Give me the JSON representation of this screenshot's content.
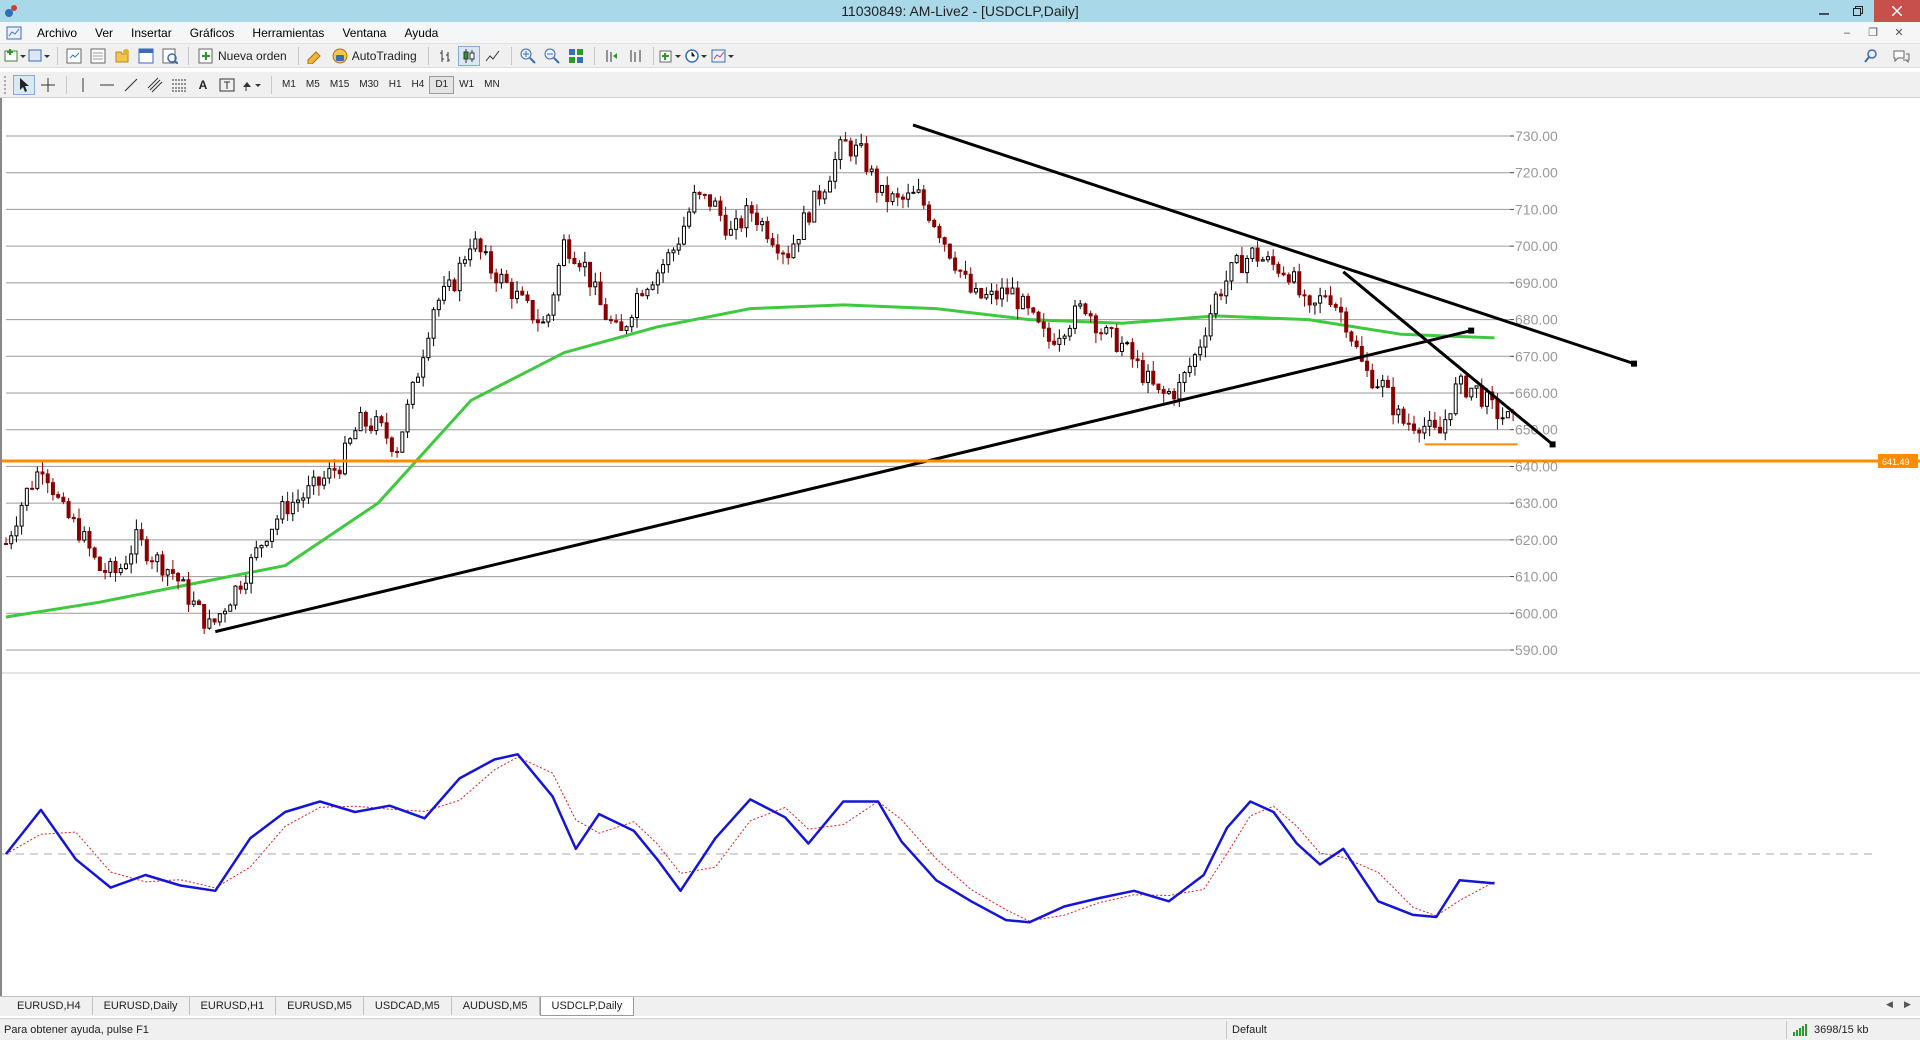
{
  "window": {
    "title": "11030849: AM-Live2 - [USDCLP,Daily]",
    "controls": [
      "minimize",
      "maximize",
      "close"
    ]
  },
  "menu": {
    "items": [
      "Archivo",
      "Ver",
      "Insertar",
      "Gráficos",
      "Herramientas",
      "Ventana",
      "Ayuda"
    ]
  },
  "toolbar": {
    "new_order_label": "Nueva orden",
    "autotrading_label": "AutoTrading",
    "timeframes": [
      "M1",
      "M5",
      "M15",
      "M30",
      "H1",
      "H4",
      "D1",
      "W1",
      "MN"
    ],
    "active_timeframe": "D1"
  },
  "chart": {
    "symbol": "USDCLP",
    "period": "Daily",
    "price_axis_labels": [
      "730.00",
      "720.00",
      "710.00",
      "700.00",
      "690.00",
      "680.00",
      "670.00",
      "660.00",
      "650.00",
      "640.00",
      "630.00",
      "620.00",
      "610.00",
      "600.00",
      "590.00"
    ],
    "horizontal_line_price": "641.49",
    "colors": {
      "bull_candle": "#000000",
      "bear_candle": "#8b0000",
      "moving_average": "#3fc93f",
      "trendline": "#000000",
      "horizontal_line": "#ff8c00",
      "oscillator_main": "#1515d8",
      "oscillator_signal": "#e02020",
      "grid": "#9a9a9a"
    }
  },
  "chart_data": {
    "type": "candlestick",
    "instrument": "USDCLP",
    "timeframe": "Daily",
    "ylim": [
      588,
      733
    ],
    "price_ticks": [
      730,
      720,
      710,
      700,
      690,
      680,
      670,
      660,
      650,
      640,
      630,
      620,
      610,
      600,
      590
    ],
    "close_path": [
      [
        0,
        619
      ],
      [
        8,
        632
      ],
      [
        16,
        641
      ],
      [
        24,
        628
      ],
      [
        32,
        622
      ],
      [
        40,
        612
      ],
      [
        48,
        611
      ],
      [
        56,
        620
      ],
      [
        64,
        615
      ],
      [
        72,
        611
      ],
      [
        80,
        603
      ],
      [
        88,
        596
      ],
      [
        96,
        604
      ],
      [
        104,
        612
      ],
      [
        112,
        622
      ],
      [
        120,
        629
      ],
      [
        128,
        632
      ],
      [
        136,
        636
      ],
      [
        144,
        641
      ],
      [
        152,
        652
      ],
      [
        160,
        651
      ],
      [
        168,
        645
      ],
      [
        176,
        663
      ],
      [
        184,
        684
      ],
      [
        192,
        689
      ],
      [
        200,
        702
      ],
      [
        208,
        694
      ],
      [
        216,
        689
      ],
      [
        224,
        683
      ],
      [
        232,
        678
      ],
      [
        240,
        701
      ],
      [
        248,
        696
      ],
      [
        256,
        683
      ],
      [
        264,
        675
      ],
      [
        272,
        688
      ],
      [
        280,
        693
      ],
      [
        288,
        700
      ],
      [
        296,
        713
      ],
      [
        304,
        712
      ],
      [
        312,
        703
      ],
      [
        320,
        710
      ],
      [
        328,
        704
      ],
      [
        336,
        698
      ],
      [
        344,
        708
      ],
      [
        352,
        717
      ],
      [
        360,
        728
      ],
      [
        368,
        725
      ],
      [
        376,
        714
      ],
      [
        384,
        712
      ],
      [
        392,
        714
      ],
      [
        400,
        706
      ],
      [
        408,
        696
      ],
      [
        416,
        686
      ],
      [
        424,
        686
      ],
      [
        432,
        688
      ],
      [
        440,
        681
      ],
      [
        448,
        674
      ],
      [
        456,
        679
      ],
      [
        464,
        684
      ],
      [
        472,
        676
      ],
      [
        480,
        673
      ],
      [
        488,
        666
      ],
      [
        496,
        659
      ],
      [
        504,
        661
      ],
      [
        512,
        671
      ],
      [
        520,
        686
      ],
      [
        528,
        694
      ],
      [
        536,
        698
      ],
      [
        544,
        695
      ],
      [
        552,
        693
      ],
      [
        560,
        681
      ],
      [
        568,
        688
      ],
      [
        576,
        680
      ],
      [
        584,
        666
      ],
      [
        592,
        662
      ],
      [
        600,
        652
      ],
      [
        608,
        652
      ],
      [
        616,
        648
      ],
      [
        624,
        662
      ],
      [
        632,
        661
      ],
      [
        640,
        655
      ],
      [
        648,
        652
      ]
    ],
    "moving_average": [
      [
        0,
        599
      ],
      [
        40,
        603
      ],
      [
        80,
        608
      ],
      [
        120,
        613
      ],
      [
        160,
        630
      ],
      [
        200,
        658
      ],
      [
        240,
        671
      ],
      [
        280,
        678
      ],
      [
        320,
        683
      ],
      [
        360,
        684
      ],
      [
        400,
        683
      ],
      [
        440,
        680
      ],
      [
        480,
        679
      ],
      [
        520,
        681
      ],
      [
        560,
        680
      ],
      [
        600,
        676
      ],
      [
        640,
        675
      ]
    ],
    "horizontal_line": 641.49,
    "trendlines": [
      {
        "from": [
          90,
          595
        ],
        "to": [
          630,
          677
        ]
      },
      {
        "from": [
          390,
          733
        ],
        "to": [
          700,
          668
        ]
      },
      {
        "from": [
          575,
          693
        ],
        "to": [
          665,
          646
        ]
      },
      {
        "from": [
          610,
          646
        ],
        "to": [
          650,
          646
        ]
      }
    ],
    "oscillator": {
      "main": [
        [
          0,
          0
        ],
        [
          15,
          4.2
        ],
        [
          30,
          -0.5
        ],
        [
          45,
          -3.2
        ],
        [
          60,
          -2.0
        ],
        [
          75,
          -3.0
        ],
        [
          90,
          -3.5
        ],
        [
          105,
          1.5
        ],
        [
          120,
          4.0
        ],
        [
          135,
          5.0
        ],
        [
          150,
          4.0
        ],
        [
          165,
          4.6
        ],
        [
          180,
          3.4
        ],
        [
          195,
          7.2
        ],
        [
          210,
          9.0
        ],
        [
          220,
          9.5
        ],
        [
          235,
          5.5
        ],
        [
          245,
          0.5
        ],
        [
          255,
          3.8
        ],
        [
          270,
          2.2
        ],
        [
          280,
          -0.5
        ],
        [
          290,
          -3.5
        ],
        [
          305,
          1.5
        ],
        [
          320,
          5.2
        ],
        [
          335,
          3.5
        ],
        [
          345,
          1.0
        ],
        [
          360,
          5.0
        ],
        [
          375,
          5.0
        ],
        [
          385,
          1.2
        ],
        [
          400,
          -2.5
        ],
        [
          415,
          -4.5
        ],
        [
          430,
          -6.3
        ],
        [
          440,
          -6.5
        ],
        [
          455,
          -5.0
        ],
        [
          470,
          -4.2
        ],
        [
          485,
          -3.5
        ],
        [
          500,
          -4.5
        ],
        [
          515,
          -2.0
        ],
        [
          525,
          2.5
        ],
        [
          535,
          5.0
        ],
        [
          545,
          4.0
        ],
        [
          555,
          1.0
        ],
        [
          565,
          -1.0
        ],
        [
          575,
          0.5
        ],
        [
          590,
          -4.5
        ],
        [
          605,
          -5.8
        ],
        [
          615,
          -6.0
        ],
        [
          625,
          -2.5
        ],
        [
          640,
          -2.8
        ]
      ],
      "zero_level": 0
    }
  },
  "tabs": {
    "items": [
      "EURUSD,H4",
      "EURUSD,Daily",
      "EURUSD,H1",
      "EURUSD,M5",
      "USDCAD,M5",
      "AUDUSD,M5",
      "USDCLP,Daily"
    ],
    "active": "USDCLP,Daily"
  },
  "status": {
    "help_text": "Para obtener ayuda, pulse F1",
    "profile": "Default",
    "traffic": "3698/15 kb"
  }
}
